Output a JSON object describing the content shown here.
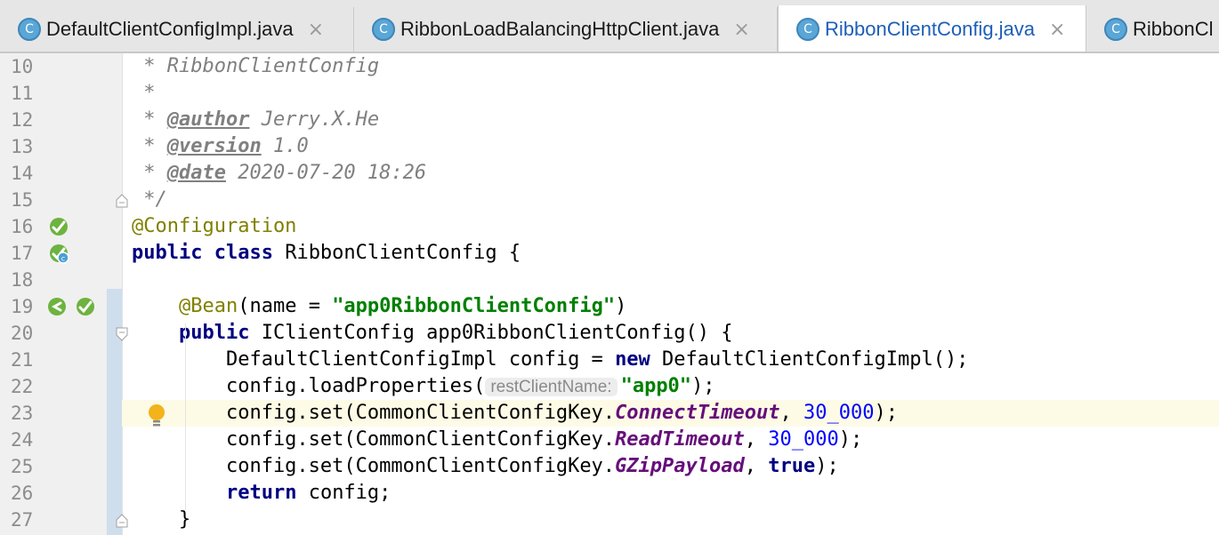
{
  "tabs": [
    {
      "label": "DefaultClientConfigImpl.java",
      "icon": "class-icon",
      "icon_glyph": "C",
      "active": false
    },
    {
      "label": "RibbonLoadBalancingHttpClient.java",
      "icon": "class-icon",
      "icon_glyph": "C",
      "active": false
    },
    {
      "label": "RibbonClientConfig.java",
      "icon": "class-icon",
      "icon_glyph": "C",
      "active": true
    },
    {
      "label": "RibbonCl",
      "icon": "class-icon",
      "icon_glyph": "C",
      "active": false
    }
  ],
  "close_glyph": "×",
  "lines": [
    {
      "n": "10",
      "t": [
        [
          "doc",
          " * RibbonClientConfig"
        ]
      ]
    },
    {
      "n": "11",
      "t": [
        [
          "doc",
          " *"
        ]
      ]
    },
    {
      "n": "12",
      "t": [
        [
          "doc",
          " * "
        ],
        [
          "tag",
          "@author"
        ],
        [
          "doc",
          " Jerry.X.He"
        ]
      ]
    },
    {
      "n": "13",
      "t": [
        [
          "doc",
          " * "
        ],
        [
          "tag",
          "@version"
        ],
        [
          "doc",
          " 1.0"
        ]
      ]
    },
    {
      "n": "14",
      "t": [
        [
          "doc",
          " * "
        ],
        [
          "tag",
          "@date"
        ],
        [
          "doc",
          " 2020-07-20 18:26"
        ]
      ]
    },
    {
      "n": "15",
      "t": [
        [
          "doc",
          " */"
        ]
      ]
    },
    {
      "n": "16",
      "t": [
        [
          "ann",
          "@Configuration"
        ]
      ]
    },
    {
      "n": "17",
      "t": [
        [
          "kw",
          "public class"
        ],
        [
          "",
          " RibbonClientConfig {"
        ]
      ]
    },
    {
      "n": "18",
      "t": []
    },
    {
      "n": "19",
      "t": [
        [
          "",
          "    "
        ],
        [
          "ann",
          "@Bean"
        ],
        [
          "",
          "(name = "
        ],
        [
          "str",
          "\"app0RibbonClientConfig\""
        ],
        [
          "",
          ")"
        ]
      ]
    },
    {
      "n": "20",
      "t": [
        [
          "",
          "    "
        ],
        [
          "kw",
          "public"
        ],
        [
          "",
          " IClientConfig app0RibbonClientConfig() {"
        ]
      ]
    },
    {
      "n": "21",
      "t": [
        [
          "",
          "        DefaultClientConfigImpl config = "
        ],
        [
          "kw",
          "new"
        ],
        [
          "",
          " DefaultClientConfigImpl();"
        ]
      ]
    },
    {
      "n": "22",
      "t": [
        [
          "",
          "        config.loadProperties("
        ],
        [
          "hint",
          "restClientName:"
        ],
        [
          "str",
          "\"app0\""
        ],
        [
          "",
          ");"
        ]
      ]
    },
    {
      "n": "23",
      "t": [
        [
          "",
          "        config.set(CommonClientConfigKey."
        ],
        [
          "field",
          "ConnectTimeout"
        ],
        [
          "",
          ", "
        ],
        [
          "num",
          "30_000"
        ],
        [
          "",
          ");"
        ]
      ],
      "current": true
    },
    {
      "n": "24",
      "t": [
        [
          "",
          "        config.set(CommonClientConfigKey."
        ],
        [
          "field",
          "ReadTimeout"
        ],
        [
          "",
          ", "
        ],
        [
          "num",
          "30_000"
        ],
        [
          "",
          ");"
        ]
      ]
    },
    {
      "n": "25",
      "t": [
        [
          "",
          "        config.set(CommonClientConfigKey."
        ],
        [
          "field",
          "GZipPayload"
        ],
        [
          "",
          ", "
        ],
        [
          "kw",
          "true"
        ],
        [
          "",
          ");"
        ]
      ]
    },
    {
      "n": "26",
      "t": [
        [
          "",
          "        "
        ],
        [
          "kw",
          "return"
        ],
        [
          "",
          " config;"
        ]
      ]
    },
    {
      "n": "27",
      "t": [
        [
          "",
          "    }"
        ]
      ]
    }
  ],
  "gutter_icons": {
    "16": [
      "spring-bean-icon"
    ],
    "17": [
      "spring-config-icon"
    ],
    "19": [
      "navigate-back-icon",
      "spring-bean-icon"
    ],
    "23": [
      "lightbulb-icon"
    ]
  },
  "fold_markers": {
    "15": "fold-end-icon",
    "20": "fold-start-icon",
    "27": "fold-end-icon"
  }
}
